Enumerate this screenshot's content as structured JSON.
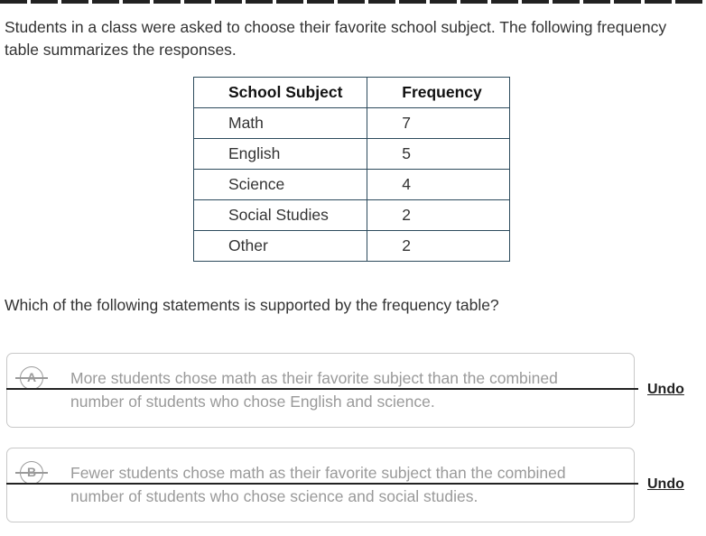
{
  "question": {
    "intro": "Students in a class were asked to choose their favorite school subject. The following frequency table summarizes the responses.",
    "prompt": "Which of the following statements is supported by the frequency table?"
  },
  "table": {
    "headers": [
      "School Subject",
      "Frequency"
    ],
    "rows": [
      {
        "subject": "Math",
        "frequency": "7"
      },
      {
        "subject": "English",
        "frequency": "5"
      },
      {
        "subject": "Science",
        "frequency": "4"
      },
      {
        "subject": "Social Studies",
        "frequency": "2"
      },
      {
        "subject": "Other",
        "frequency": "2"
      }
    ]
  },
  "choices": [
    {
      "letter": "A",
      "text": "More students chose math as their favorite subject than the combined number of students who chose English and science.",
      "eliminated": true,
      "undo_label": "Undo"
    },
    {
      "letter": "B",
      "text": "Fewer students chose math as their favorite subject than the combined number of students who chose science and social studies.",
      "eliminated": true,
      "undo_label": "Undo"
    }
  ]
}
